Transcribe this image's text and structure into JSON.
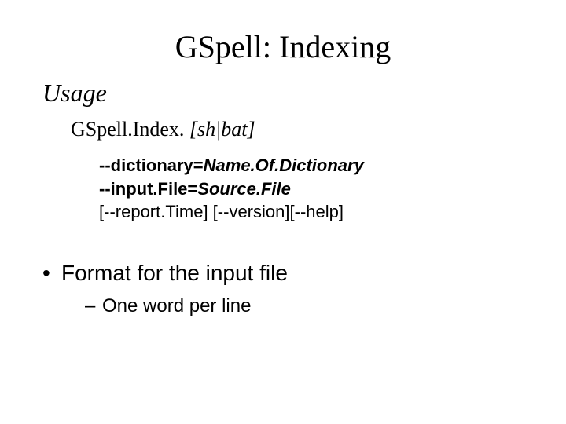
{
  "title": "GSpell: Indexing",
  "usage_heading": "Usage",
  "command": {
    "program": "GSpell.Index. ",
    "script_args": "[sh|bat]"
  },
  "options": {
    "line1_flag": "--dictionary=",
    "line1_value": "Name.Of.Dictionary",
    "line2_flag": "--input.File=",
    "line2_value": "Source.File",
    "line3_a_open": "[",
    "line3_a_flag": "--report.Time",
    "line3_a_close": "] ",
    "line3_b_open": "[",
    "line3_b_flag": "--version",
    "line3_b_close": "]",
    "line3_c_open": "[",
    "line3_c_flag": "--help",
    "line3_c_close": "]"
  },
  "format": {
    "bullet_text": "Format for the input file",
    "sub_text": "One word per line"
  },
  "glyphs": {
    "bullet": "•",
    "dash": "–"
  }
}
